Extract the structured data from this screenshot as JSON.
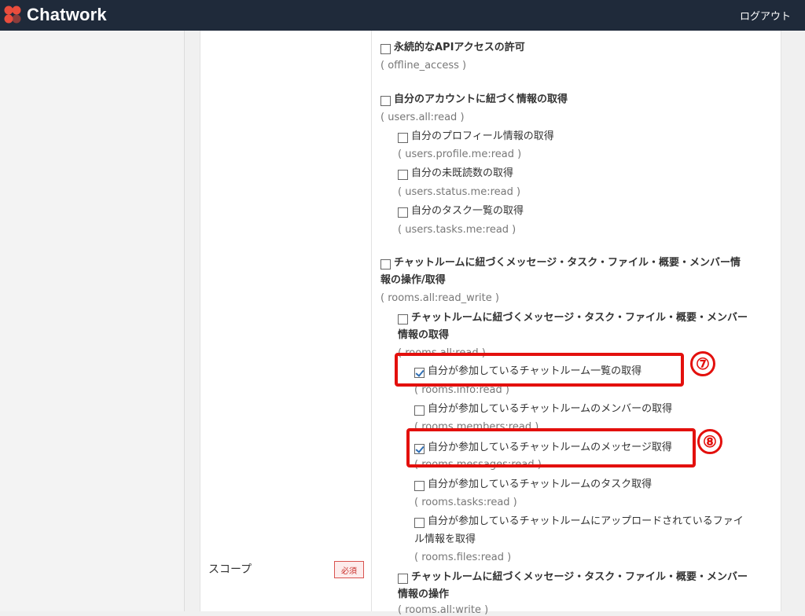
{
  "header": {
    "brand": "Chatwork",
    "logout_label": "ログアウト"
  },
  "form": {
    "scope_label": "スコープ",
    "required_badge": "必須",
    "scopes": [
      {
        "label": "永続的なAPIアクセスの許可",
        "code": "( offline_access )",
        "checked": false,
        "bold": true
      },
      {
        "label": "自分のアカウントに紐づく情報の取得",
        "code": "( users.all:read )",
        "checked": false,
        "bold": true
      },
      {
        "label": "自分のプロフィール情報の取得",
        "code": "( users.profile.me:read )",
        "checked": false
      },
      {
        "label": "自分の未既読数の取得",
        "code": "( users.status.me:read )",
        "checked": false
      },
      {
        "label": "自分のタスク一覧の取得",
        "code": "( users.tasks.me:read )",
        "checked": false
      },
      {
        "label_line1": "チャットルームに紐づくメッセージ・タスク・ファイル・概要・メンバー情",
        "label_line2": "報の操作/取得",
        "code": "( rooms.all:read_write )",
        "checked": false,
        "bold": true
      },
      {
        "label_line1": "チャットルームに紐づくメッセージ・タスク・ファイル・概要・メンバー",
        "label_line2": "情報の取得",
        "code": "( rooms.all:read )",
        "checked": false,
        "bold": true
      },
      {
        "label": "自分が参加しているチャットルーム一覧の取得",
        "code": "( rooms.info:read )",
        "checked": true
      },
      {
        "label": "自分が参加しているチャットルームのメンバーの取得",
        "code": "( rooms.members:read )",
        "checked": false
      },
      {
        "label": "自分か参加しているチャットルームのメッセージ取得",
        "code": "( rooms.messages:read )",
        "checked": true
      },
      {
        "label": "自分が参加しているチャットルームのタスク取得",
        "code": "( rooms.tasks:read )",
        "checked": false
      },
      {
        "label_line1": "自分が参加しているチャットルームにアップロードされているファイ",
        "label_line2": "ル情報を取得",
        "code": "( rooms.files:read )",
        "checked": false
      },
      {
        "label_line1": "チャットルームに紐づくメッセージ・タスク・ファイル・概要・メンバー",
        "label_line2": "情報の操作",
        "code": "( rooms.all:write )",
        "checked": false,
        "bold": true
      }
    ]
  },
  "annotations": {
    "badge_7": "⑦",
    "badge_8": "⑧"
  },
  "colors": {
    "header_bg": "#1f2a3a",
    "highlight": "#e3100d",
    "check": "#2f6fb5"
  }
}
